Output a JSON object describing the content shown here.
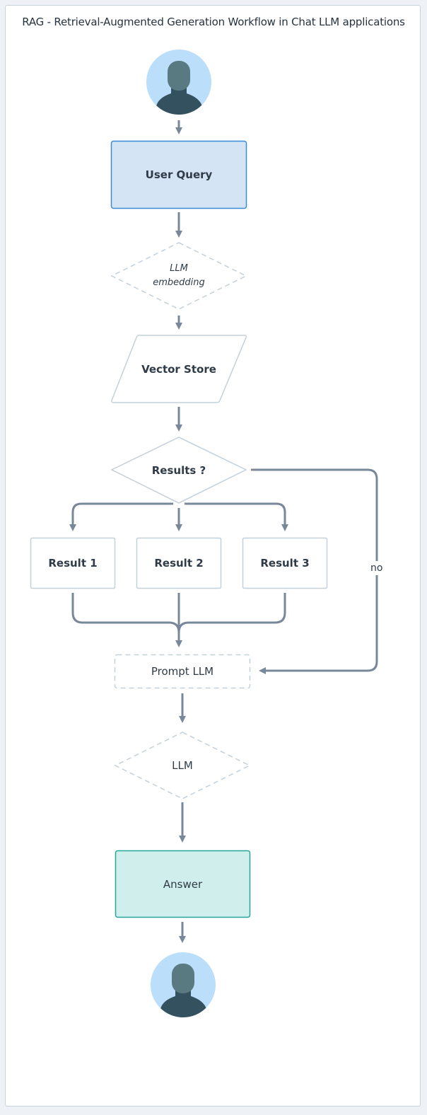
{
  "title": "RAG - Retrieval-Augmented Generation Workflow in Chat LLM applications",
  "colors": {
    "edge": "#78889a",
    "node_border": "#c4d0da",
    "user_query_fill": "#d4e4f5",
    "user_query_border": "#3b8ad8",
    "answer_fill": "#cfeeec",
    "answer_border": "#26a69a",
    "avatar_bg": "#bbdefb",
    "avatar_head": "#5a7a82",
    "avatar_body": "#33515f"
  },
  "nodes": {
    "user_start": {
      "type": "actor",
      "icon": "user-avatar-icon"
    },
    "user_query": {
      "label": "User Query"
    },
    "llm_embedding": {
      "line1": "LLM",
      "line2": "embedding"
    },
    "vector_store": {
      "label": "Vector Store"
    },
    "results_decision": {
      "label": "Results ?"
    },
    "result_1": {
      "label": "Result 1"
    },
    "result_2": {
      "label": "Result 2"
    },
    "result_3": {
      "label": "Result 3"
    },
    "prompt_llm": {
      "label": "Prompt LLM"
    },
    "llm": {
      "label": "LLM"
    },
    "answer": {
      "label": "Answer"
    },
    "user_end": {
      "type": "actor",
      "icon": "user-avatar-icon"
    }
  },
  "edges": {
    "no_label": "no"
  }
}
